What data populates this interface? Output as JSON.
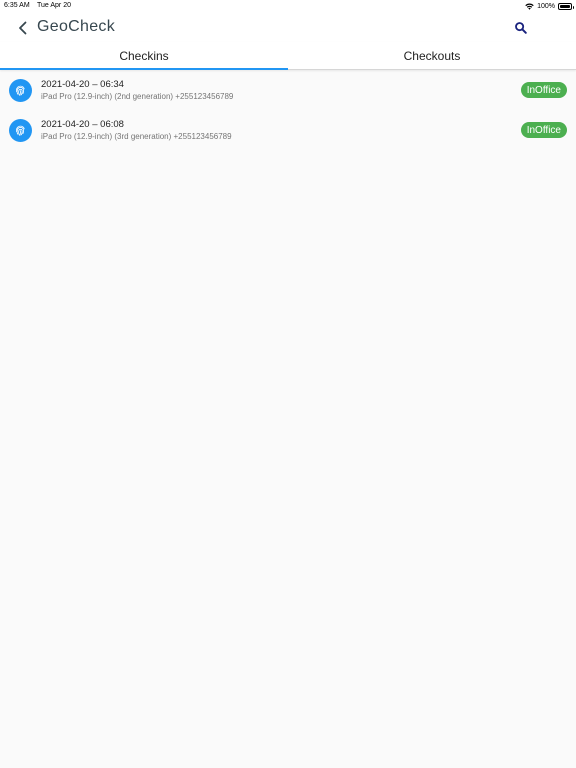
{
  "status_bar": {
    "time": "6:35 AM",
    "date": "Tue Apr 20",
    "battery_percent": "100%",
    "battery_level": 1.0
  },
  "app_bar": {
    "title": "GeoCheck",
    "back_icon": "chevron-left-icon",
    "search_icon": "search-icon"
  },
  "tabs": [
    {
      "label": "Checkins",
      "active": true
    },
    {
      "label": "Checkouts",
      "active": false
    }
  ],
  "checkins": [
    {
      "icon": "fingerprint-icon",
      "datetime": "2021-04-20 – 06:34",
      "device": "iPad Pro (12.9-inch) (2nd generation) +255123456789",
      "status": "InOffice"
    },
    {
      "icon": "fingerprint-icon",
      "datetime": "2021-04-20 – 06:08",
      "device": "iPad Pro (12.9-inch) (3rd generation) +255123456789",
      "status": "InOffice"
    }
  ],
  "colors": {
    "accent": "#2196f3",
    "status_green": "#4caf50",
    "title_text": "#37474f",
    "search_icon": "#1a237e"
  }
}
